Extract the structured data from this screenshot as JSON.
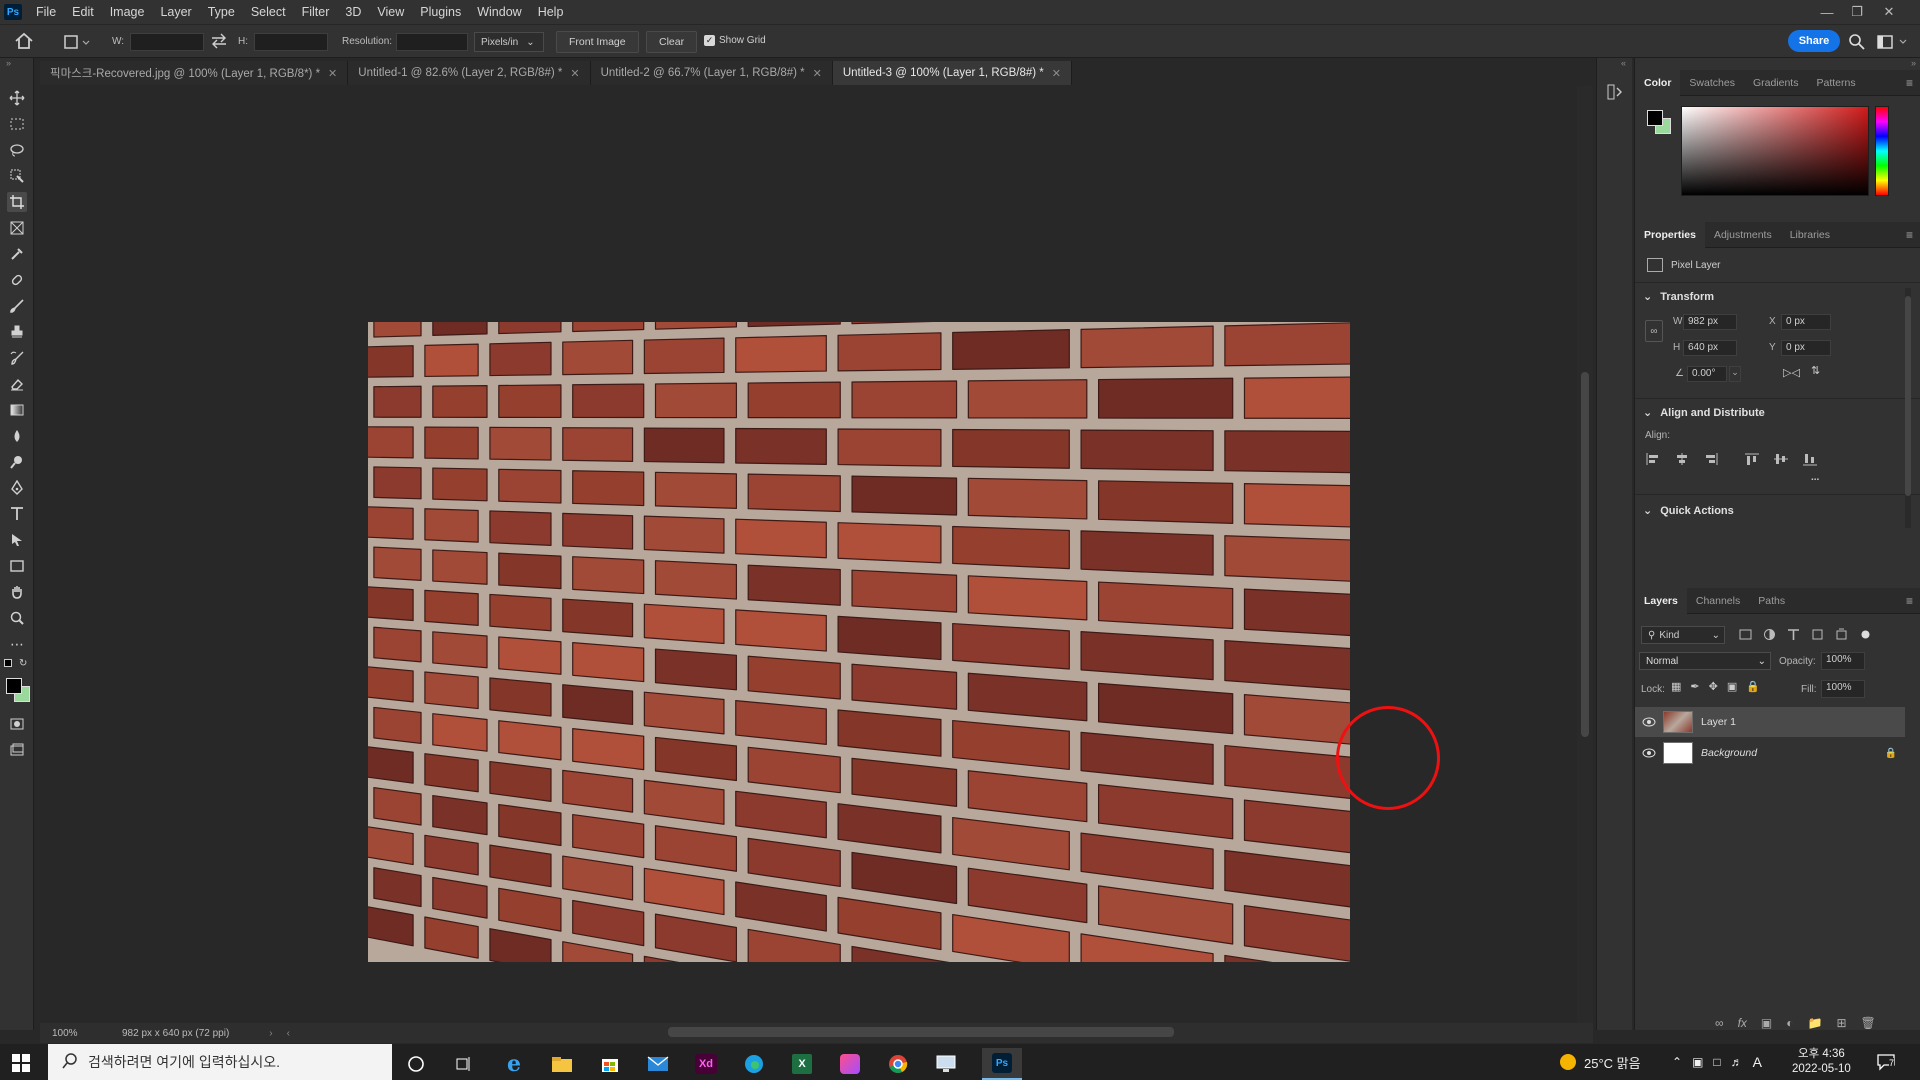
{
  "menubar": {
    "logo": "Ps",
    "items": [
      "File",
      "Edit",
      "Image",
      "Layer",
      "Type",
      "Select",
      "Filter",
      "3D",
      "View",
      "Plugins",
      "Window",
      "Help"
    ]
  },
  "options": {
    "w_label": "W:",
    "h_label": "H:",
    "resolution_label": "Resolution:",
    "units": "Pixels/in",
    "front_image": "Front Image",
    "clear": "Clear",
    "show_grid": "Show Grid",
    "share": "Share"
  },
  "tabs": [
    {
      "label": "픽마스크-Recovered.jpg @ 100% (Layer 1, RGB/8*) *"
    },
    {
      "label": "Untitled-1 @ 82.6% (Layer 2, RGB/8#) *"
    },
    {
      "label": "Untitled-2 @ 66.7% (Layer 1, RGB/8#) *"
    },
    {
      "label": "Untitled-3 @ 100% (Layer 1, RGB/8#) *"
    }
  ],
  "status": {
    "zoom": "100%",
    "doc_info": "982 px x 640 px (72 ppi)"
  },
  "color_panel": {
    "tabs": [
      "Color",
      "Swatches",
      "Gradients",
      "Patterns"
    ],
    "foreground": "#000000",
    "background": "#9bd89b",
    "hue_color": "#d11a1a"
  },
  "properties": {
    "tabs": [
      "Properties",
      "Adjustments",
      "Libraries"
    ],
    "layer_type": "Pixel Layer",
    "transform_title": "Transform",
    "w_label": "W",
    "w_value": "982 px",
    "h_label": "H",
    "h_value": "640 px",
    "x_label": "X",
    "x_value": "0 px",
    "y_label": "Y",
    "y_value": "0 px",
    "angle": "0.00°",
    "align_title": "Align and Distribute",
    "align_label": "Align:",
    "more": "...",
    "quick_actions": "Quick Actions"
  },
  "layers": {
    "tabs": [
      "Layers",
      "Channels",
      "Paths"
    ],
    "kind": "Kind",
    "blend_mode": "Normal",
    "opacity_label": "Opacity:",
    "opacity": "100%",
    "lock_label": "Lock:",
    "fill_label": "Fill:",
    "fill": "100%",
    "items": [
      {
        "name": "Layer 1"
      },
      {
        "name": "Background"
      }
    ]
  },
  "taskbar": {
    "search_placeholder": "검색하려면 여기에 입력하십시오.",
    "weather": "25°C  맑음",
    "ime": "A",
    "time": "오후 4:36",
    "date": "2022-05-10",
    "notifications": "7"
  }
}
